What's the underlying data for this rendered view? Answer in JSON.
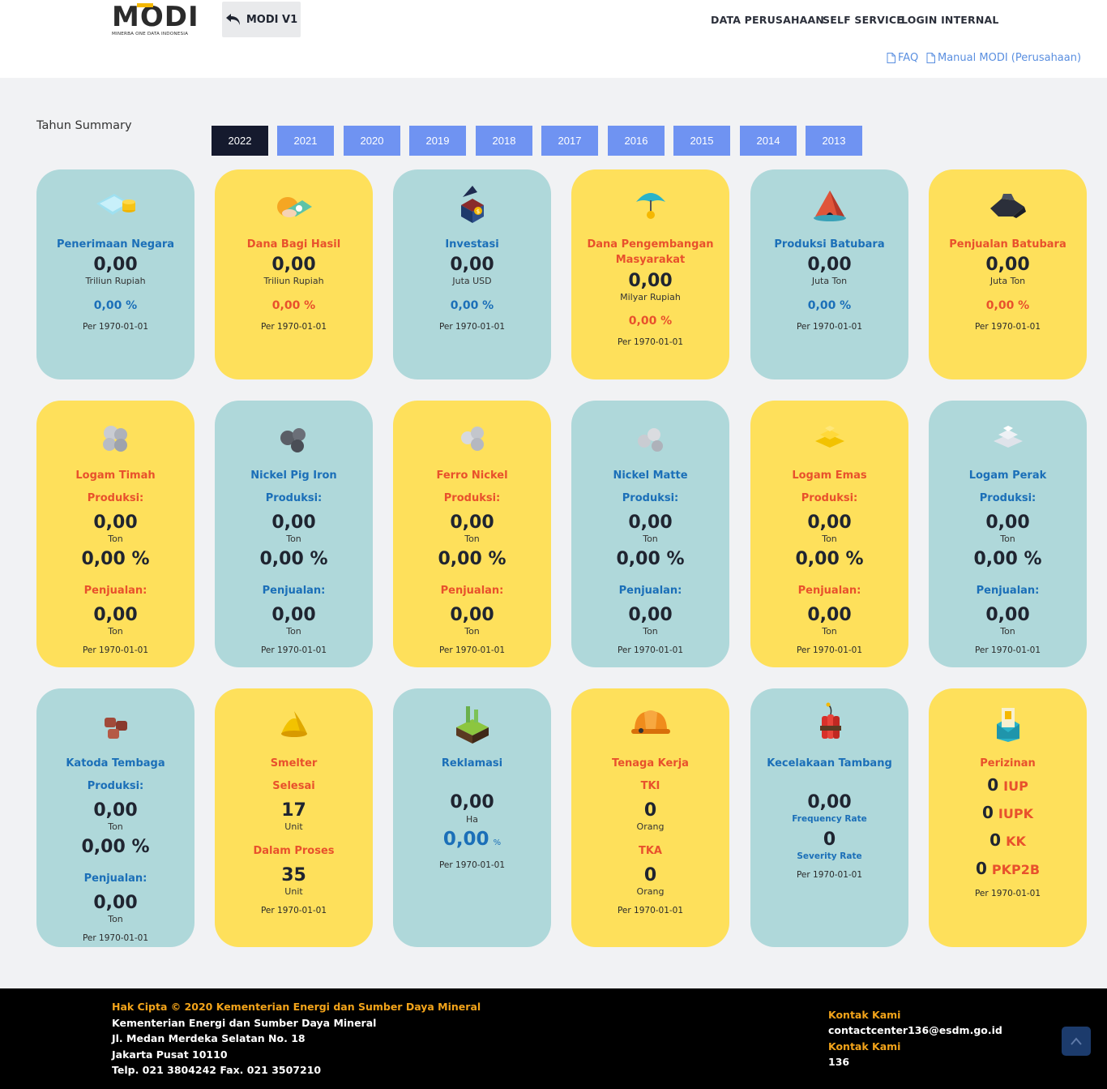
{
  "header": {
    "logo_text": "MODI",
    "logo_sub": "MINERBA ONE DATA INDONESIA",
    "back_label": "MODI V1",
    "nav": [
      "DATA PERUSAHAAN",
      "SELF SERVICE",
      "LOGIN INTERNAL"
    ],
    "faq": "FAQ",
    "manual": "Manual MODI (Perusahaan)"
  },
  "summary": {
    "label": "Tahun Summary",
    "years": [
      "2022",
      "2021",
      "2020",
      "2019",
      "2018",
      "2017",
      "2016",
      "2015",
      "2014",
      "2013"
    ],
    "active_year": "2022"
  },
  "colors": {
    "teal": "#afd8da",
    "yellow": "#fee05b",
    "blue_text": "#1b6fb8",
    "orange_text": "#e8512c",
    "active_tab": "#151a2e",
    "tab": "#6f93f2"
  },
  "row1": [
    {
      "title": "Penerimaan Negara",
      "value": "0,00",
      "unit": "Triliun Rupiah",
      "pct": "0,00 %",
      "per": "Per 1970-01-01",
      "icon": "money-icon"
    },
    {
      "title": "Dana Bagi Hasil",
      "value": "0,00",
      "unit": "Triliun Rupiah",
      "pct": "0,00 %",
      "per": "Per 1970-01-01",
      "icon": "cash-hand-icon"
    },
    {
      "title": "Investasi",
      "value": "0,00",
      "unit": "Juta USD",
      "pct": "0,00 %",
      "per": "Per 1970-01-01",
      "icon": "investment-house-icon"
    },
    {
      "title": "Dana Pengembangan Masyarakat",
      "value": "0,00",
      "unit": "Milyar Rupiah",
      "pct": "0,00 %",
      "per": "Per 1970-01-01",
      "icon": "umbrella-icon"
    },
    {
      "title": "Produksi Batubara",
      "value": "0,00",
      "unit": "Juta Ton",
      "pct": "0,00 %",
      "per": "Per 1970-01-01",
      "icon": "coal-mine-icon"
    },
    {
      "title": "Penjualan Batubara",
      "value": "0,00",
      "unit": "Juta Ton",
      "pct": "0,00 %",
      "per": "Per 1970-01-01",
      "icon": "coal-icon"
    }
  ],
  "row2": [
    {
      "title": "Logam Timah",
      "prod_label": "Produksi:",
      "prod": "0,00",
      "unit": "Ton",
      "pct": "0,00 %",
      "sale_label": "Penjualan:",
      "sale": "0,00",
      "sale_unit": "Ton",
      "per": "Per 1970-01-01",
      "icon": "tin-ore-icon"
    },
    {
      "title": "Nickel Pig Iron",
      "prod_label": "Produksi:",
      "prod": "0,00",
      "unit": "Ton",
      "pct": "0,00 %",
      "sale_label": "Penjualan:",
      "sale": "0,00",
      "sale_unit": "Ton",
      "per": "Per 1970-01-01",
      "icon": "pig-iron-icon"
    },
    {
      "title": "Ferro Nickel",
      "prod_label": "Produksi:",
      "prod": "0,00",
      "unit": "Ton",
      "pct": "0,00 %",
      "sale_label": "Penjualan:",
      "sale": "0,00",
      "sale_unit": "Ton",
      "per": "Per 1970-01-01",
      "icon": "ferro-nickel-icon"
    },
    {
      "title": "Nickel Matte",
      "prod_label": "Produksi:",
      "prod": "0,00",
      "unit": "Ton",
      "pct": "0,00 %",
      "sale_label": "Penjualan:",
      "sale": "0,00",
      "sale_unit": "Ton",
      "per": "Per 1970-01-01",
      "icon": "nickel-matte-icon"
    },
    {
      "title": "Logam Emas",
      "prod_label": "Produksi:",
      "prod": "0,00",
      "unit": "Ton",
      "pct": "0,00 %",
      "sale_label": "Penjualan:",
      "sale": "0,00",
      "sale_unit": "Ton",
      "per": "Per 1970-01-01",
      "icon": "gold-bars-icon"
    },
    {
      "title": "Logam Perak",
      "prod_label": "Produksi:",
      "prod": "0,00",
      "unit": "Ton",
      "pct": "0,00 %",
      "sale_label": "Penjualan:",
      "sale": "0,00",
      "sale_unit": "Ton",
      "per": "Per 1970-01-01",
      "icon": "silver-bars-icon"
    }
  ],
  "row3": {
    "tembaga": {
      "title": "Katoda Tembaga",
      "prod_label": "Produksi:",
      "prod": "0,00",
      "unit": "Ton",
      "pct": "0,00 %",
      "sale_label": "Penjualan:",
      "sale": "0,00",
      "sale_unit": "Ton",
      "per": "Per 1970-01-01",
      "icon": "copper-icon"
    },
    "smelter": {
      "title": "Smelter",
      "done_label": "Selesai",
      "done": "17",
      "done_unit": "Unit",
      "proc_label": "Dalam Proses",
      "proc": "35",
      "proc_unit": "Unit",
      "per": "Per 1970-01-01",
      "icon": "smelter-icon"
    },
    "reklamasi": {
      "title": "Reklamasi",
      "value": "0,00",
      "unit": "Ha",
      "pct": "0,00",
      "pct_sign": "%",
      "per": "Per 1970-01-01",
      "icon": "land-icon"
    },
    "tenaga": {
      "title": "Tenaga Kerja",
      "tki_label": "TKI",
      "tki": "0",
      "tki_unit": "Orang",
      "tka_label": "TKA",
      "tka": "0",
      "tka_unit": "Orang",
      "per": "Per 1970-01-01",
      "icon": "helmet-icon"
    },
    "kecelakaan": {
      "title": "Kecelakaan Tambang",
      "freq": "0,00",
      "freq_label": "Frequency Rate",
      "sev": "0",
      "sev_label": "Severity Rate",
      "per": "Per 1970-01-01",
      "icon": "dynamite-icon"
    },
    "perizinan": {
      "title": "Perizinan",
      "items": [
        {
          "n": "0",
          "k": "IUP"
        },
        {
          "n": "0",
          "k": "IUPK"
        },
        {
          "n": "0",
          "k": "KK"
        },
        {
          "n": "0",
          "k": "PKP2B"
        }
      ],
      "per": "Per 1970-01-01",
      "icon": "license-icon"
    }
  },
  "footer": {
    "copyright": "Hak Cipta © 2020 Kementerian Energi dan Sumber Daya Mineral",
    "org": "Kementerian Energi dan Sumber Daya Mineral",
    "addr1": "Jl. Medan Merdeka Selatan No. 18",
    "addr2": "Jakarta Pusat 10110",
    "phone": "Telp. 021 3804242 Fax. 021 3507210",
    "contact_label1": "Kontak Kami",
    "email": "contactcenter136@esdm.go.id",
    "contact_label2": "Kontak Kami",
    "hotline": "136"
  }
}
